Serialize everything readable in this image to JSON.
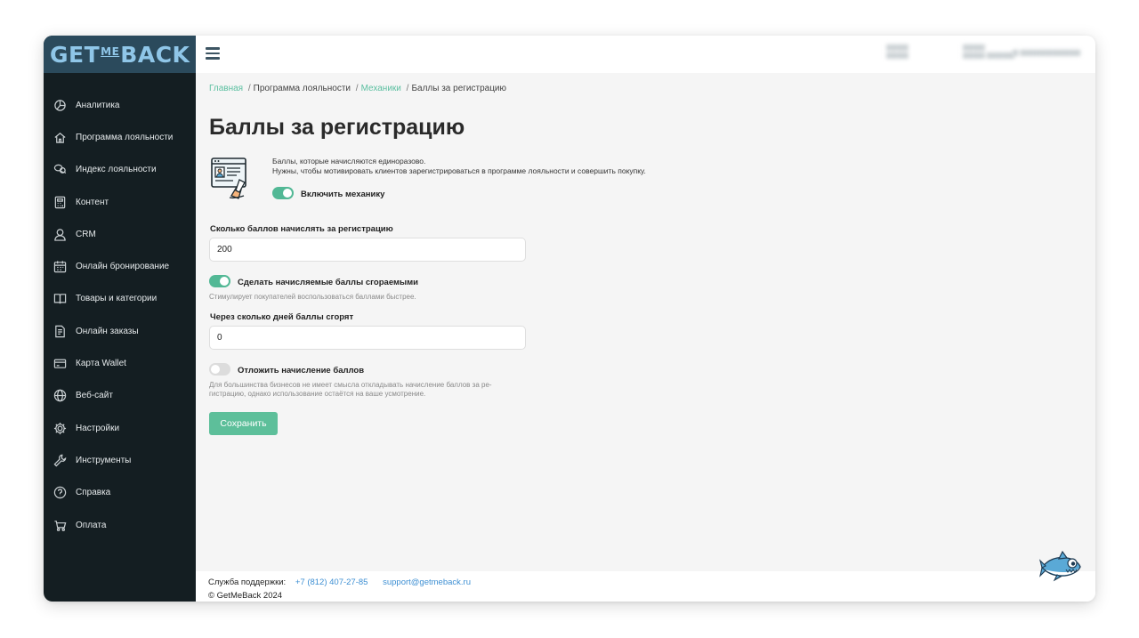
{
  "logo": {
    "part1": "GET",
    "part2": "ME",
    "part3": "BACK"
  },
  "sidebar": {
    "items": [
      {
        "label": "Аналитика",
        "icon": "analytics-icon"
      },
      {
        "label": "Программа лояльности",
        "icon": "home-icon"
      },
      {
        "label": "Индекс лояльности",
        "icon": "chat-icon"
      },
      {
        "label": "Контент",
        "icon": "calculator-icon"
      },
      {
        "label": "CRM",
        "icon": "user-icon"
      },
      {
        "label": "Онлайн бронирование",
        "icon": "calendar-icon"
      },
      {
        "label": "Товары и категории",
        "icon": "book-icon"
      },
      {
        "label": "Онлайн заказы",
        "icon": "order-icon"
      },
      {
        "label": "Карта Wallet",
        "icon": "card-icon"
      },
      {
        "label": "Веб-сайт",
        "icon": "globe-icon"
      },
      {
        "label": "Настройки",
        "icon": "gear-icon"
      },
      {
        "label": "Инструменты",
        "icon": "wrench-icon"
      },
      {
        "label": "Справка",
        "icon": "help-icon"
      },
      {
        "label": "Оплата",
        "icon": "payment-icon"
      }
    ]
  },
  "breadcrumb": {
    "home": "Главная",
    "program": "Программа лояльности",
    "mechanics": "Механики",
    "current": "Баллы за регистрацию"
  },
  "page": {
    "title": "Баллы за регистрацию",
    "desc_line1": "Баллы, которые начисляются единоразово.",
    "desc_line2": "Нужны, чтобы мотивировать клиентов зарегистрироваться в программе лояльности и совершить покупку."
  },
  "mechanic_toggle": {
    "label": "Включить механику",
    "on": true
  },
  "points_field": {
    "label": "Сколько баллов начислять за регистрацию",
    "value": "200"
  },
  "expire_toggle": {
    "label": "Сделать начисляемые баллы сгораемыми",
    "hint": "Стимулирует покупателей воспользоваться баллами быстрее.",
    "on": true
  },
  "days_field": {
    "label": "Через сколько дней баллы сгорят",
    "value": "0"
  },
  "delay_toggle": {
    "label": "Отложить начисление баллов",
    "hint_line1": "Для большинства бизнесов не имеет смысла откладывать начисление баллов за ре-",
    "hint_line2": "гистрацию, однако использование остаётся на ваше усмотрение.",
    "on": false
  },
  "save_button": {
    "label": "Сохранить"
  },
  "footer": {
    "support_label": "Служба поддержки:",
    "phone": "+7 (812) 407-27-85",
    "email": "support@getmeback.ru",
    "copyright": "© GetMeBack 2024"
  },
  "colors": {
    "accent": "#5dbf9a",
    "sidebar": "#141e22",
    "logo_bg": "#2b4a5c",
    "link": "#3d8fd3"
  }
}
